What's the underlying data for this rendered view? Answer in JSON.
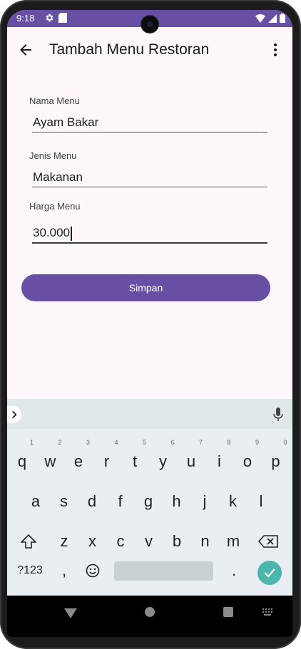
{
  "status_bar": {
    "time": "9:18",
    "left_icons": [
      "settings-icon",
      "sd-card-icon"
    ],
    "right_icons": [
      "wifi-icon",
      "signal-icon",
      "battery-icon"
    ]
  },
  "app_bar": {
    "title": "Tambah Menu Restoran",
    "back_icon": "arrow-back-icon",
    "overflow_icon": "more-vert-icon"
  },
  "form": {
    "nama_menu": {
      "label": "Nama Menu",
      "value": "Ayam Bakar"
    },
    "jenis_menu": {
      "label": "Jenis Menu",
      "value": "Makanan"
    },
    "harga_menu": {
      "label": "Harga Menu",
      "value": "30.000"
    },
    "submit_label": "Simpan"
  },
  "keyboard": {
    "row1": [
      {
        "key": "q",
        "hint": "1"
      },
      {
        "key": "w",
        "hint": "2"
      },
      {
        "key": "e",
        "hint": "3"
      },
      {
        "key": "r",
        "hint": "4"
      },
      {
        "key": "t",
        "hint": "5"
      },
      {
        "key": "y",
        "hint": "6"
      },
      {
        "key": "u",
        "hint": "7"
      },
      {
        "key": "i",
        "hint": "8"
      },
      {
        "key": "o",
        "hint": "9"
      },
      {
        "key": "p",
        "hint": "0"
      }
    ],
    "row2": [
      "a",
      "s",
      "d",
      "f",
      "g",
      "h",
      "j",
      "k",
      "l"
    ],
    "row3": [
      "z",
      "x",
      "c",
      "v",
      "b",
      "n",
      "m"
    ],
    "symbols_label": "?123",
    "comma": ",",
    "period": "."
  },
  "colors": {
    "primary": "#6750a4",
    "surface": "#fdf7fc",
    "keyboard_bg": "#e8eef1",
    "enter_key": "#4db6ac"
  }
}
